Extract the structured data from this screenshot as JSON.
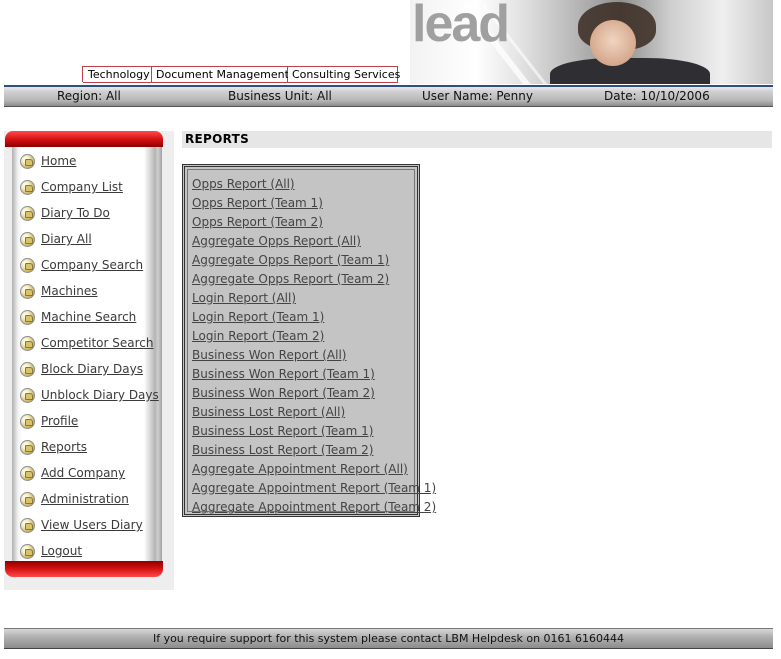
{
  "header": {
    "logo_text": "lead",
    "tabs": [
      {
        "label": "Technology"
      },
      {
        "label": "Document Management"
      },
      {
        "label": "Consulting Services"
      }
    ]
  },
  "info_bar": {
    "region": "Region: All",
    "business_unit": "Business Unit: All",
    "user_name": "User Name: Penny",
    "date": "Date: 10/10/2006"
  },
  "sidebar": {
    "items": [
      {
        "label": "Home"
      },
      {
        "label": "Company List"
      },
      {
        "label": "Diary To Do"
      },
      {
        "label": "Diary All"
      },
      {
        "label": "Company Search"
      },
      {
        "label": "Machines"
      },
      {
        "label": "Machine Search"
      },
      {
        "label": "Competitor Search"
      },
      {
        "label": "Block Diary Days"
      },
      {
        "label": "Unblock Diary Days"
      },
      {
        "label": "Profile"
      },
      {
        "label": "Reports"
      },
      {
        "label": "Add Company"
      },
      {
        "label": "Administration"
      },
      {
        "label": "View Users Diary"
      },
      {
        "label": "Logout"
      }
    ]
  },
  "main": {
    "section_title": "REPORTS",
    "reports": [
      {
        "label": "Opps Report (All)"
      },
      {
        "label": "Opps Report (Team 1)"
      },
      {
        "label": "Opps Report (Team 2)"
      },
      {
        "label": "Aggregate Opps Report (All)"
      },
      {
        "label": "Aggregate Opps Report (Team 1)"
      },
      {
        "label": "Aggregate Opps Report (Team 2)"
      },
      {
        "label": "Login Report (All)"
      },
      {
        "label": "Login Report (Team 1)"
      },
      {
        "label": "Login Report (Team 2)"
      },
      {
        "label": "Business Won Report (All)"
      },
      {
        "label": "Business Won Report (Team 1)"
      },
      {
        "label": "Business Won Report (Team 2)"
      },
      {
        "label": "Business Lost Report (All)"
      },
      {
        "label": "Business Lost Report (Team 1)"
      },
      {
        "label": "Business Lost Report (Team 2)"
      },
      {
        "label": "Aggregate Appointment Report (All)"
      },
      {
        "label": "Aggregate Appointment Report (Team 1)"
      },
      {
        "label": "Aggregate Appointment Report (Team 2)"
      }
    ]
  },
  "footer": {
    "support_text": "If you require support for this system please contact LBM Helpdesk on 0161 6160444"
  },
  "icons": {
    "nav_bullet": "folder-bullet-icon"
  },
  "colors": {
    "accent_red": "#d10f0f",
    "header_blue_line": "#2f4e86",
    "tab_border": "#c0404a",
    "report_box_bg": "#c4c4c4"
  }
}
